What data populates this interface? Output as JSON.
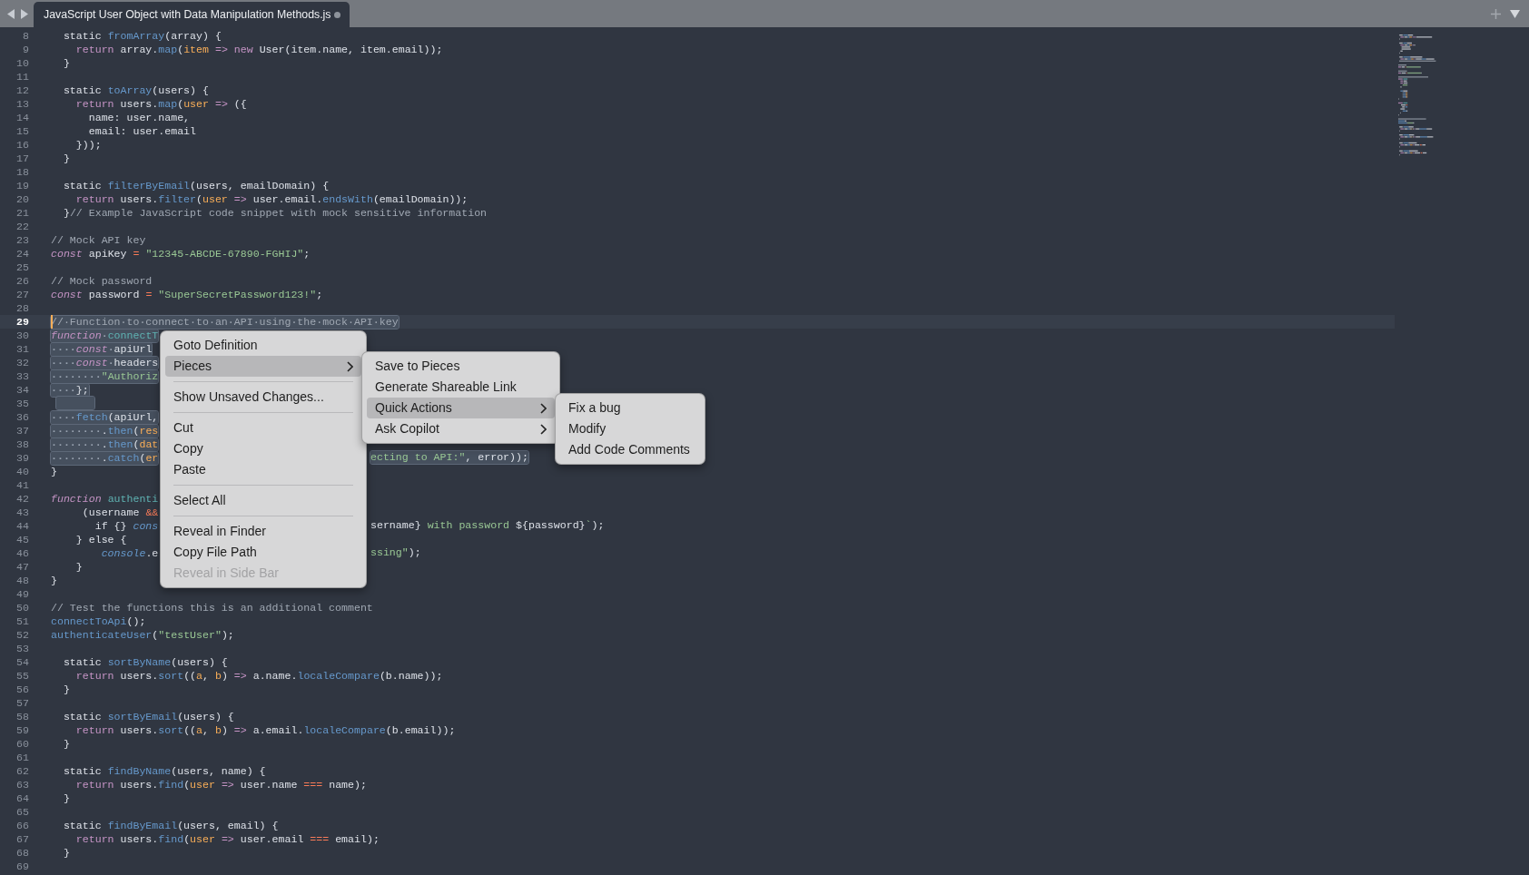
{
  "tab_bar": {
    "tabs": [
      {
        "title": "JavaScript User Object with Data Manipulation Methods.js",
        "selected": true,
        "dirty": true
      }
    ]
  },
  "editor": {
    "lines": [
      {
        "number": "8",
        "selected": false,
        "current": false,
        "tokens": [
          {
            "kind": "p",
            "text": "  static "
          },
          {
            "kind": "fn",
            "text": "fromArray"
          },
          {
            "kind": "p",
            "text": "(array) {"
          }
        ]
      },
      {
        "number": "9",
        "selected": false,
        "current": false,
        "tokens": [
          {
            "kind": "kw",
            "text": "    return"
          },
          {
            "kind": "p",
            "text": " array."
          },
          {
            "kind": "fn",
            "text": "map"
          },
          {
            "kind": "p",
            "text": "("
          },
          {
            "kind": "param",
            "text": "item"
          },
          {
            "kind": "kw",
            "text": " =>"
          },
          {
            "kind": "kw",
            "text": " new"
          },
          {
            "kind": "p",
            "text": " User(item.name, item.email));"
          }
        ]
      },
      {
        "number": "10",
        "selected": false,
        "current": false,
        "tokens": [
          {
            "kind": "p",
            "text": "  }"
          }
        ]
      },
      {
        "number": "11",
        "selected": false,
        "current": false
      },
      {
        "number": "12",
        "selected": false,
        "current": false,
        "tokens": [
          {
            "kind": "p",
            "text": "  static "
          },
          {
            "kind": "fn",
            "text": "toArray"
          },
          {
            "kind": "p",
            "text": "(users) {"
          }
        ]
      },
      {
        "number": "13",
        "selected": false,
        "current": false,
        "tokens": [
          {
            "kind": "kw",
            "text": "    return"
          },
          {
            "kind": "p",
            "text": " users."
          },
          {
            "kind": "fn",
            "text": "map"
          },
          {
            "kind": "p",
            "text": "("
          },
          {
            "kind": "param",
            "text": "user"
          },
          {
            "kind": "kw",
            "text": " =>"
          },
          {
            "kind": "p",
            "text": " ({"
          }
        ]
      },
      {
        "number": "14",
        "selected": false,
        "current": false,
        "tokens": [
          {
            "kind": "p",
            "text": "      name: user.name,"
          }
        ]
      },
      {
        "number": "15",
        "selected": false,
        "current": false,
        "tokens": [
          {
            "kind": "p",
            "text": "      email: user.email"
          }
        ]
      },
      {
        "number": "16",
        "selected": false,
        "current": false,
        "tokens": [
          {
            "kind": "p",
            "text": "    }));"
          }
        ]
      },
      {
        "number": "17",
        "selected": false,
        "current": false,
        "tokens": [
          {
            "kind": "p",
            "text": "  }"
          }
        ]
      },
      {
        "number": "18",
        "selected": false,
        "current": false
      },
      {
        "number": "19",
        "selected": false,
        "current": false,
        "tokens": [
          {
            "kind": "p",
            "text": "  static "
          },
          {
            "kind": "fn",
            "text": "filterByEmail"
          },
          {
            "kind": "p",
            "text": "(users, emailDomain) {"
          }
        ]
      },
      {
        "number": "20",
        "selected": false,
        "current": false,
        "tokens": [
          {
            "kind": "kw",
            "text": "    return"
          },
          {
            "kind": "p",
            "text": " users."
          },
          {
            "kind": "fn",
            "text": "filter"
          },
          {
            "kind": "p",
            "text": "("
          },
          {
            "kind": "param",
            "text": "user"
          },
          {
            "kind": "kw",
            "text": " =>"
          },
          {
            "kind": "p",
            "text": " user.email."
          },
          {
            "kind": "fn",
            "text": "endsWith"
          },
          {
            "kind": "p",
            "text": "(emailDomain));"
          }
        ]
      },
      {
        "number": "21",
        "selected": false,
        "current": false,
        "tokens": [
          {
            "kind": "p",
            "text": "  }"
          },
          {
            "kind": "cm",
            "text": "// Example JavaScript code snippet with mock sensitive information"
          }
        ]
      },
      {
        "number": "22",
        "selected": false,
        "current": false
      },
      {
        "number": "23",
        "selected": false,
        "current": false,
        "tokens": [
          {
            "kind": "cm",
            "text": "// Mock API key"
          }
        ]
      },
      {
        "number": "24",
        "selected": false,
        "current": false,
        "tokens": [
          {
            "kind": "kwi",
            "text": "const"
          },
          {
            "kind": "p",
            "text": " apiKey "
          },
          {
            "kind": "op",
            "text": "="
          },
          {
            "kind": "str",
            "text": " \"12345-ABCDE-67890-FGHIJ\""
          },
          {
            "kind": "p",
            "text": ";"
          }
        ]
      },
      {
        "number": "25",
        "selected": false,
        "current": false
      },
      {
        "number": "26",
        "selected": false,
        "current": false,
        "tokens": [
          {
            "kind": "cm",
            "text": "// Mock password"
          }
        ]
      },
      {
        "number": "27",
        "selected": false,
        "current": false,
        "tokens": [
          {
            "kind": "kwi",
            "text": "const"
          },
          {
            "kind": "p",
            "text": " password "
          },
          {
            "kind": "op",
            "text": "="
          },
          {
            "kind": "str",
            "text": " \"SuperSecretPassword123!\""
          },
          {
            "kind": "p",
            "text": ";"
          }
        ]
      },
      {
        "number": "28",
        "selected": false,
        "current": false
      },
      {
        "number": "29",
        "selected": true,
        "current": true,
        "tokens": [
          {
            "kind": "cm",
            "text": "//·Function·to·connect·to·an·API·using·the·mock·API·key"
          }
        ]
      },
      {
        "number": "30",
        "selected": true,
        "current": false,
        "tokens": [
          {
            "kind": "kwi",
            "text": "function"
          },
          {
            "kind": "ws",
            "text": "·"
          },
          {
            "kind": "fn2",
            "text": "connectT"
          }
        ]
      },
      {
        "number": "31",
        "selected": true,
        "current": false,
        "tokens": [
          {
            "kind": "ws",
            "text": "····"
          },
          {
            "kind": "kwi",
            "text": "const"
          },
          {
            "kind": "ws",
            "text": "·"
          },
          {
            "kind": "p",
            "text": "apiUrl"
          }
        ]
      },
      {
        "number": "32",
        "selected": true,
        "current": false,
        "tokens": [
          {
            "kind": "ws",
            "text": "····"
          },
          {
            "kind": "kwi",
            "text": "const"
          },
          {
            "kind": "ws",
            "text": "·"
          },
          {
            "kind": "p",
            "text": "headers"
          }
        ]
      },
      {
        "number": "33",
        "selected": true,
        "current": false,
        "tokens": [
          {
            "kind": "ws",
            "text": "········"
          },
          {
            "kind": "str",
            "text": "\"Authoriz"
          }
        ]
      },
      {
        "number": "34",
        "selected": true,
        "current": false,
        "tokens": [
          {
            "kind": "ws",
            "text": "····"
          },
          {
            "kind": "p",
            "text": "};"
          }
        ]
      },
      {
        "number": "35",
        "selected": true,
        "current": false
      },
      {
        "number": "36",
        "selected": true,
        "current": false,
        "tokens": [
          {
            "kind": "ws",
            "text": "····"
          },
          {
            "kind": "fn",
            "text": "fetch"
          },
          {
            "kind": "p",
            "text": "(apiUrl,"
          }
        ]
      },
      {
        "number": "37",
        "selected": true,
        "current": false,
        "tokens": [
          {
            "kind": "ws",
            "text": "········"
          },
          {
            "kind": "p",
            "text": "."
          },
          {
            "kind": "fn",
            "text": "then"
          },
          {
            "kind": "p",
            "text": "("
          },
          {
            "kind": "param",
            "text": "res"
          }
        ]
      },
      {
        "number": "38",
        "selected": true,
        "current": false,
        "tokens": [
          {
            "kind": "ws",
            "text": "········"
          },
          {
            "kind": "p",
            "text": "."
          },
          {
            "kind": "fn",
            "text": "then"
          },
          {
            "kind": "p",
            "text": "("
          },
          {
            "kind": "param",
            "text": "dat"
          }
        ]
      },
      {
        "number": "39",
        "selected": true,
        "current": false,
        "tokens": [
          {
            "kind": "ws",
            "text": "········"
          },
          {
            "kind": "p",
            "text": "."
          },
          {
            "kind": "fn",
            "text": "catch"
          },
          {
            "kind": "p",
            "text": "("
          },
          {
            "kind": "param",
            "text": "er"
          }
        ],
        "tail": [
          {
            "kind": "str",
            "text": "ecting to API:\""
          },
          {
            "kind": "p",
            "text": ", error));"
          }
        ]
      },
      {
        "number": "40",
        "selected": false,
        "current": false,
        "tokens": [
          {
            "kind": "p",
            "text": "}"
          }
        ]
      },
      {
        "number": "41",
        "selected": false,
        "current": false
      },
      {
        "number": "42",
        "selected": false,
        "current": false,
        "tokens": [
          {
            "kind": "kwi",
            "text": "function"
          },
          {
            "kind": "fn2",
            "text": " authenti"
          }
        ]
      },
      {
        "number": "43",
        "selected": false,
        "current": false,
        "tokens": [
          {
            "kind": "p",
            "text": "     (username "
          },
          {
            "kind": "op",
            "text": "&&"
          }
        ]
      },
      {
        "number": "44",
        "selected": false,
        "current": false,
        "tokens": [
          {
            "kind": "p",
            "text": "       if {} "
          },
          {
            "kind": "fni",
            "text": "cons"
          }
        ],
        "tail": [
          {
            "kind": "p",
            "text": "sername} "
          },
          {
            "kind": "str",
            "text": "with password "
          },
          {
            "kind": "p",
            "text": "${password}"
          },
          {
            "kind": "str",
            "text": "`"
          },
          {
            "kind": "p",
            "text": ");"
          }
        ]
      },
      {
        "number": "45",
        "selected": false,
        "current": false,
        "tokens": [
          {
            "kind": "p",
            "text": "    } else {"
          }
        ]
      },
      {
        "number": "46",
        "selected": false,
        "current": false,
        "tokens": [
          {
            "kind": "fni",
            "text": "        console"
          },
          {
            "kind": "p",
            "text": ".e"
          }
        ],
        "tail": [
          {
            "kind": "str",
            "text": "ssing\""
          },
          {
            "kind": "p",
            "text": ");"
          }
        ]
      },
      {
        "number": "47",
        "selected": false,
        "current": false,
        "tokens": [
          {
            "kind": "p",
            "text": "    }"
          }
        ]
      },
      {
        "number": "48",
        "selected": false,
        "current": false,
        "tokens": [
          {
            "kind": "p",
            "text": "}"
          }
        ]
      },
      {
        "number": "49",
        "selected": false,
        "current": false
      },
      {
        "number": "50",
        "selected": false,
        "current": false,
        "tokens": [
          {
            "kind": "cm",
            "text": "// Test the functions this is an additional comment"
          }
        ]
      },
      {
        "number": "51",
        "selected": false,
        "current": false,
        "tokens": [
          {
            "kind": "fn",
            "text": "connectToApi"
          },
          {
            "kind": "p",
            "text": "();"
          }
        ]
      },
      {
        "number": "52",
        "selected": false,
        "current": false,
        "tokens": [
          {
            "kind": "fn",
            "text": "authenticateUser"
          },
          {
            "kind": "p",
            "text": "("
          },
          {
            "kind": "str",
            "text": "\"testUser\""
          },
          {
            "kind": "p",
            "text": ");"
          }
        ]
      },
      {
        "number": "53",
        "selected": false,
        "current": false
      },
      {
        "number": "54",
        "selected": false,
        "current": false,
        "tokens": [
          {
            "kind": "p",
            "text": "  static "
          },
          {
            "kind": "fn",
            "text": "sortByName"
          },
          {
            "kind": "p",
            "text": "(users) {"
          }
        ]
      },
      {
        "number": "55",
        "selected": false,
        "current": false,
        "tokens": [
          {
            "kind": "kw",
            "text": "    return"
          },
          {
            "kind": "p",
            "text": " users."
          },
          {
            "kind": "fn",
            "text": "sort"
          },
          {
            "kind": "p",
            "text": "(("
          },
          {
            "kind": "param",
            "text": "a"
          },
          {
            "kind": "p",
            "text": ", "
          },
          {
            "kind": "param",
            "text": "b"
          },
          {
            "kind": "p",
            "text": ")"
          },
          {
            "kind": "kw",
            "text": " =>"
          },
          {
            "kind": "p",
            "text": " a.name."
          },
          {
            "kind": "fn",
            "text": "localeCompare"
          },
          {
            "kind": "p",
            "text": "(b.name));"
          }
        ]
      },
      {
        "number": "56",
        "selected": false,
        "current": false,
        "tokens": [
          {
            "kind": "p",
            "text": "  }"
          }
        ]
      },
      {
        "number": "57",
        "selected": false,
        "current": false
      },
      {
        "number": "58",
        "selected": false,
        "current": false,
        "tokens": [
          {
            "kind": "p",
            "text": "  static "
          },
          {
            "kind": "fn",
            "text": "sortByEmail"
          },
          {
            "kind": "p",
            "text": "(users) {"
          }
        ]
      },
      {
        "number": "59",
        "selected": false,
        "current": false,
        "tokens": [
          {
            "kind": "kw",
            "text": "    return"
          },
          {
            "kind": "p",
            "text": " users."
          },
          {
            "kind": "fn",
            "text": "sort"
          },
          {
            "kind": "p",
            "text": "(("
          },
          {
            "kind": "param",
            "text": "a"
          },
          {
            "kind": "p",
            "text": ", "
          },
          {
            "kind": "param",
            "text": "b"
          },
          {
            "kind": "p",
            "text": ")"
          },
          {
            "kind": "kw",
            "text": " =>"
          },
          {
            "kind": "p",
            "text": " a.email."
          },
          {
            "kind": "fn",
            "text": "localeCompare"
          },
          {
            "kind": "p",
            "text": "(b.email));"
          }
        ]
      },
      {
        "number": "60",
        "selected": false,
        "current": false,
        "tokens": [
          {
            "kind": "p",
            "text": "  }"
          }
        ]
      },
      {
        "number": "61",
        "selected": false,
        "current": false
      },
      {
        "number": "62",
        "selected": false,
        "current": false,
        "tokens": [
          {
            "kind": "p",
            "text": "  static "
          },
          {
            "kind": "fn",
            "text": "findByName"
          },
          {
            "kind": "p",
            "text": "(users, name) {"
          }
        ]
      },
      {
        "number": "63",
        "selected": false,
        "current": false,
        "tokens": [
          {
            "kind": "kw",
            "text": "    return"
          },
          {
            "kind": "p",
            "text": " users."
          },
          {
            "kind": "fn",
            "text": "find"
          },
          {
            "kind": "p",
            "text": "("
          },
          {
            "kind": "param",
            "text": "user"
          },
          {
            "kind": "kw",
            "text": " =>"
          },
          {
            "kind": "p",
            "text": " user.name "
          },
          {
            "kind": "op",
            "text": "==="
          },
          {
            "kind": "p",
            "text": " name);"
          }
        ]
      },
      {
        "number": "64",
        "selected": false,
        "current": false,
        "tokens": [
          {
            "kind": "p",
            "text": "  }"
          }
        ]
      },
      {
        "number": "65",
        "selected": false,
        "current": false
      },
      {
        "number": "66",
        "selected": false,
        "current": false,
        "tokens": [
          {
            "kind": "p",
            "text": "  static "
          },
          {
            "kind": "fn",
            "text": "findByEmail"
          },
          {
            "kind": "p",
            "text": "(users, email) {"
          }
        ]
      },
      {
        "number": "67",
        "selected": false,
        "current": false,
        "tokens": [
          {
            "kind": "kw",
            "text": "    return"
          },
          {
            "kind": "p",
            "text": " users."
          },
          {
            "kind": "fn",
            "text": "find"
          },
          {
            "kind": "p",
            "text": "("
          },
          {
            "kind": "param",
            "text": "user"
          },
          {
            "kind": "kw",
            "text": " =>"
          },
          {
            "kind": "p",
            "text": " user.email "
          },
          {
            "kind": "op",
            "text": "==="
          },
          {
            "kind": "p",
            "text": " email);"
          }
        ]
      },
      {
        "number": "68",
        "selected": false,
        "current": false,
        "tokens": [
          {
            "kind": "p",
            "text": "  }"
          }
        ]
      },
      {
        "number": "69",
        "selected": false,
        "current": false
      }
    ]
  },
  "context_menu": {
    "items": [
      {
        "kind": "item",
        "label": "Goto Definition",
        "selected": false,
        "disabled": false,
        "submenu": false
      },
      {
        "kind": "item",
        "label": "Pieces",
        "selected": true,
        "disabled": false,
        "submenu": true,
        "children": [
          {
            "kind": "item",
            "label": "Save to Pieces",
            "selected": false,
            "disabled": false,
            "submenu": false
          },
          {
            "kind": "item",
            "label": "Generate Shareable Link",
            "selected": false,
            "disabled": false,
            "submenu": false
          },
          {
            "kind": "item",
            "label": "Quick Actions",
            "selected": true,
            "disabled": false,
            "submenu": true,
            "children": [
              {
                "kind": "item",
                "label": "Fix a bug",
                "selected": false,
                "disabled": false,
                "submenu": false
              },
              {
                "kind": "item",
                "label": "Modify",
                "selected": false,
                "disabled": false,
                "submenu": false
              },
              {
                "kind": "item",
                "label": "Add Code Comments",
                "selected": false,
                "disabled": false,
                "submenu": false
              }
            ]
          },
          {
            "kind": "item",
            "label": "Ask Copilot",
            "selected": false,
            "disabled": false,
            "submenu": true
          }
        ]
      },
      {
        "kind": "separator"
      },
      {
        "kind": "item",
        "label": "Show Unsaved Changes...",
        "selected": false,
        "disabled": false,
        "submenu": false
      },
      {
        "kind": "separator"
      },
      {
        "kind": "item",
        "label": "Cut",
        "selected": false,
        "disabled": false,
        "submenu": false
      },
      {
        "kind": "item",
        "label": "Copy",
        "selected": false,
        "disabled": false,
        "submenu": false
      },
      {
        "kind": "item",
        "label": "Paste",
        "selected": false,
        "disabled": false,
        "submenu": false
      },
      {
        "kind": "separator"
      },
      {
        "kind": "item",
        "label": "Select All",
        "selected": false,
        "disabled": false,
        "submenu": false
      },
      {
        "kind": "separator"
      },
      {
        "kind": "item",
        "label": "Reveal in Finder",
        "selected": false,
        "disabled": false,
        "submenu": false
      },
      {
        "kind": "item",
        "label": "Copy File Path",
        "selected": false,
        "disabled": false,
        "submenu": false
      },
      {
        "kind": "item",
        "label": "Reveal in Side Bar",
        "selected": false,
        "disabled": true,
        "submenu": false
      }
    ]
  }
}
